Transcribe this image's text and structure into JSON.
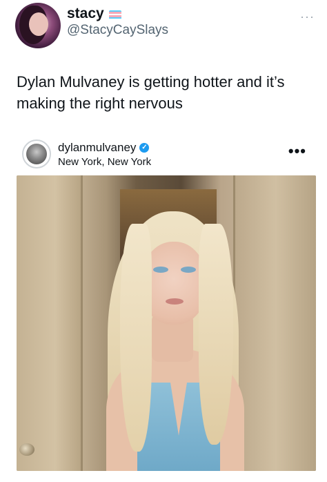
{
  "tweet": {
    "display_name": "stacy",
    "handle": "@StacyCaySlays",
    "more_icon": "···",
    "text": "Dylan Mulvaney is getting hotter and it’s making the right nervous",
    "flag_colors": [
      "#5bcefa",
      "#f5a9b8",
      "#ffffff",
      "#f5a9b8",
      "#5bcefa"
    ]
  },
  "embedded_post": {
    "username": "dylanmulvaney",
    "verified_icon": "✓",
    "location": "New York, New York",
    "more_icon": "•••"
  },
  "colors": {
    "text_primary": "#0f1419",
    "text_secondary": "#536471",
    "verified_blue": "#1d9bf0"
  }
}
